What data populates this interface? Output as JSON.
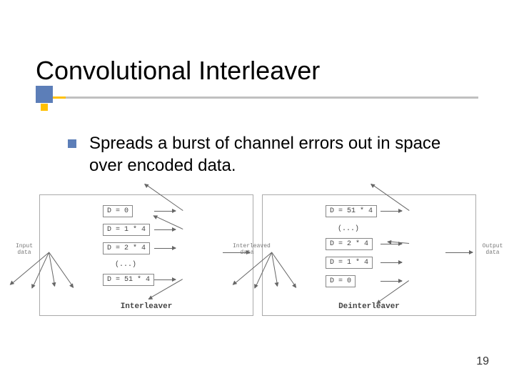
{
  "page": {
    "number": "19"
  },
  "title": "Convolutional Interleaver",
  "bullet": "Spreads a burst of channel errors out in space over encoded data.",
  "diagram": {
    "input_label": "Input\ndata",
    "mid_label": "Interleaved\ndata",
    "output_label": "Output\ndata",
    "interleaver": {
      "caption": "Interleaver",
      "rows": [
        "D = 0",
        "D = 1 * 4",
        "D = 2 * 4",
        "(...)",
        "D = 51 * 4"
      ]
    },
    "deinterleaver": {
      "caption": "Deinterleaver",
      "rows": [
        "D = 51 * 4",
        "(...)",
        "D = 2 * 4",
        "D = 1 * 4",
        "D = 0"
      ]
    }
  }
}
